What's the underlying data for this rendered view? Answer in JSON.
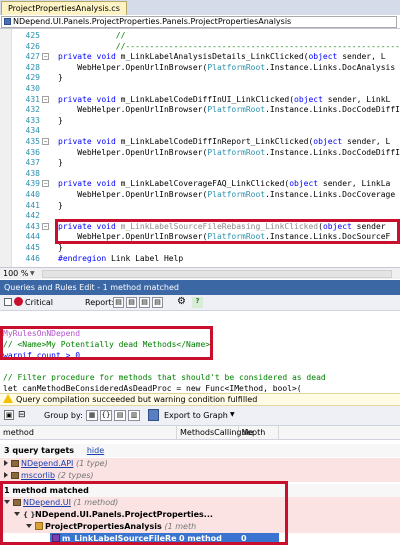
{
  "editor": {
    "tab_title": "ProjectPropertiesAnalysis.cs",
    "nav_path": "NDepend.UI.Panels.ProjectProperties.Panels.ProjectPropertiesAnalysis",
    "lines": [
      {
        "num": "425",
        "text": "            //"
      },
      {
        "num": "426",
        "text": "            //-----------------------------------------------------------"
      },
      {
        "num": "427",
        "text": "            private void m_LinkLabelAnalysisDetails_LinkClicked(object sender, L"
      },
      {
        "num": "428",
        "text": "                WebHelper.OpenUrlInBrowser(PlatformRoot.Instance.Links.DocAnalysis"
      },
      {
        "num": "429",
        "text": "            }"
      },
      {
        "num": "430",
        "text": ""
      },
      {
        "num": "431",
        "text": "            private void m_LinkLabelCodeDiffInUI_LinkClicked(object sender, LinkL"
      },
      {
        "num": "432",
        "text": "                WebHelper.OpenUrlInBrowser(PlatformRoot.Instance.Links.DocCodeDiffI"
      },
      {
        "num": "433",
        "text": "            }"
      },
      {
        "num": "434",
        "text": ""
      },
      {
        "num": "435",
        "text": "            private void m_LinkLabelCodeDiffInReport_LinkClicked(object sender, L"
      },
      {
        "num": "436",
        "text": "                WebHelper.OpenUrlInBrowser(PlatformRoot.Instance.Links.DocCodeDiffI"
      },
      {
        "num": "437",
        "text": "            }"
      },
      {
        "num": "438",
        "text": ""
      },
      {
        "num": "439",
        "text": "            private void m_LinkLabelCoverageFAQ_LinkClicked(object sender, LinkLa"
      },
      {
        "num": "440",
        "text": "                WebHelper.OpenUrlInBrowser(PlatformRoot.Instance.Links.DocCoverage"
      },
      {
        "num": "441",
        "text": "            }"
      },
      {
        "num": "442",
        "text": ""
      },
      {
        "num": "443",
        "text": "            private void m_LinkLabelSourceFileRebasing_LinkClicked(object sender"
      },
      {
        "num": "444",
        "text": "                WebHelper.OpenUrlInBrowser(PlatformRoot.Instance.Links.DocSourceF"
      },
      {
        "num": "445",
        "text": "            }"
      },
      {
        "num": "446",
        "text": "            #endregion Link Label Help"
      }
    ],
    "zoom": "100 %"
  },
  "panel": {
    "title": "Queries and Rules Edit  - 1 method matched",
    "critical_label": "Critical",
    "report_label": "Report:"
  },
  "query": {
    "lines": [
      "MyRulesOnNDepend",
      "// <Name>My Potentially dead Methods</Name>",
      "warnif count > 0",
      "",
      "// Filter procedure for methods that should't be considered as dead",
      "let canMethodBeConsideredAsDeadProc = new Func<IMethod, bool>("
    ],
    "status": "Query compilation succeeded but warning condition fulfilled"
  },
  "results": {
    "group_by_label": "Group by:",
    "export_label": "Export to Graph",
    "columns": [
      "method",
      "MethodsCallingMe",
      "depth"
    ],
    "query_targets": {
      "label": "3 query targets",
      "hide": "hide"
    },
    "targets": [
      {
        "name": "NDepend.API",
        "count": "(1 type)"
      },
      {
        "name": "mscorlib",
        "count": "(2 types)"
      }
    ],
    "matched_label": "1 method matched",
    "tree": {
      "assembly": {
        "name": "NDepend.UI",
        "count": "(1 method)"
      },
      "namespace": {
        "name": "NDepend.UI.Panels.ProjectProperties..."
      },
      "type": {
        "name": "ProjectPropertiesAnalysis",
        "count": "(1 meth"
      },
      "method": {
        "name": "m_LinkLabelSourceFileReba",
        "callers": "0 method",
        "depth": "0"
      }
    }
  },
  "colors": {
    "highlight_box": "#c8102e",
    "panel_title_bg": "#3b67a5",
    "selection": "#3874d0"
  }
}
